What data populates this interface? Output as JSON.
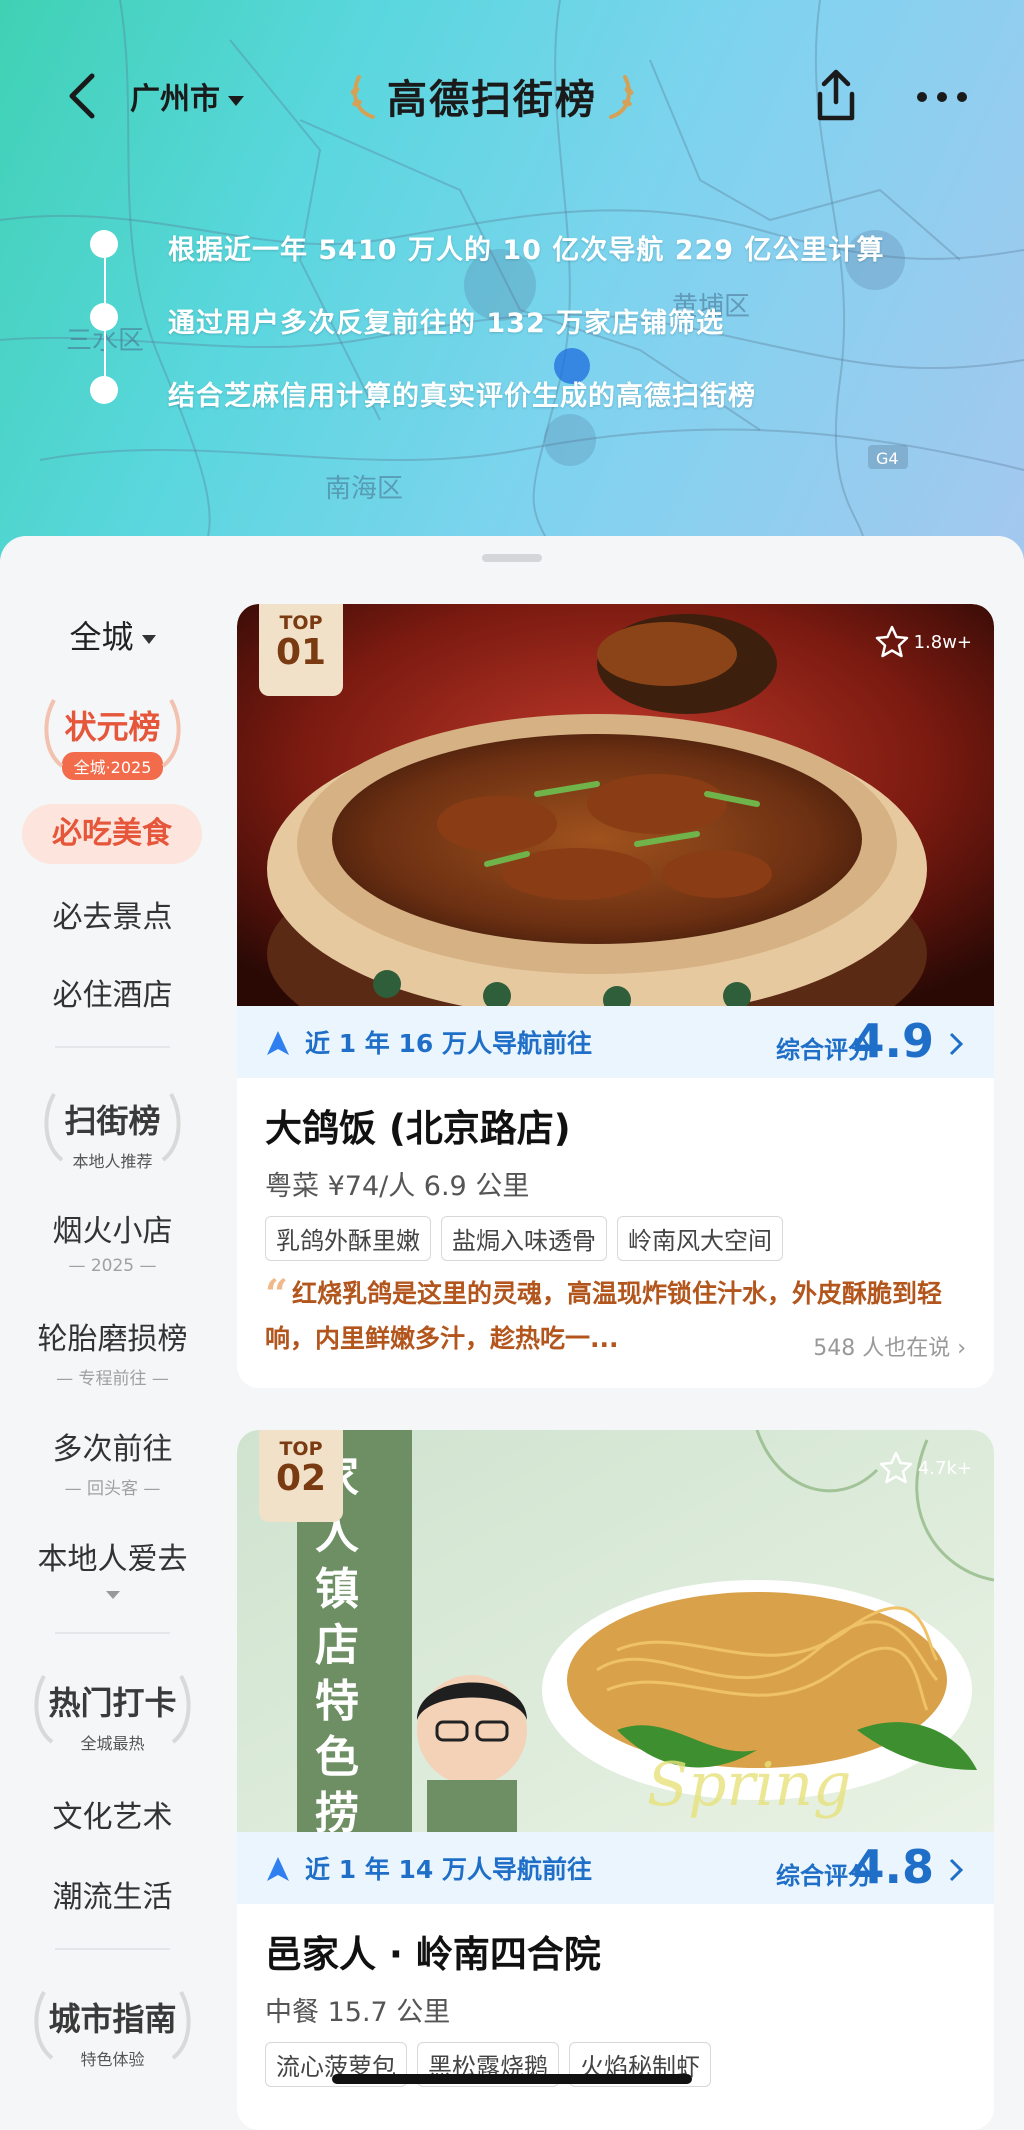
{
  "header": {
    "back_icon": "chevron-left-icon",
    "city": "广州市",
    "brand_title": "高德扫街榜",
    "share_icon": "share-icon",
    "more_icon": "more-dots-icon",
    "map_labels": [
      "三水区",
      "南海区",
      "黄埔区",
      "G4"
    ],
    "facts": [
      "根据近一年 5410 万人的 10 亿次导航 229 亿公里计算",
      "通过用户多次反复前往的 132 万家店铺筛选",
      "结合芝麻信用计算的真实评价生成的高德扫街榜"
    ]
  },
  "sidebar": {
    "scope": "全城",
    "badges": [
      {
        "title": "状元榜",
        "sub": "全城·2025"
      },
      {
        "title": "扫街榜",
        "sub": "本地人推荐"
      },
      {
        "title": "热门打卡",
        "sub": "全城最热"
      },
      {
        "title": "城市指南",
        "sub": "特色体验"
      }
    ],
    "items": [
      {
        "label": "必吃美食",
        "sub": ""
      },
      {
        "label": "必去景点",
        "sub": ""
      },
      {
        "label": "必住酒店",
        "sub": ""
      },
      {
        "label": "烟火小店",
        "sub": "2025"
      },
      {
        "label": "轮胎磨损榜",
        "sub": "专程前往"
      },
      {
        "label": "多次前往",
        "sub": "回头客"
      },
      {
        "label": "本地人爱去",
        "sub": ""
      },
      {
        "label": "文化艺术",
        "sub": ""
      },
      {
        "label": "潮流生活",
        "sub": ""
      }
    ]
  },
  "cards": [
    {
      "rank_top": "TOP",
      "rank_num": "01",
      "fav_count": "1.8w+",
      "nav_text": "近 1 年 16 万人导航前往",
      "score_label": "综合评分",
      "score": "4.9",
      "title": "大鸽饭 (北京路店)",
      "meta": "粤菜  ¥74/人  6.9 公里",
      "tags": [
        "乳鸽外酥里嫩",
        "盐焗入味透骨",
        "岭南风大空间"
      ],
      "review": "红烧乳鸽是这里的灵魂，高温现炸锁住汁水，外皮酥脆到轻响，内里鲜嫩多汁，趁热吃一...",
      "review_count": "548 人也在说"
    },
    {
      "rank_top": "TOP",
      "rank_num": "02",
      "fav_count": "4.7k+",
      "nav_text": "近 1 年 14 万人导航前往",
      "score_label": "综合评分",
      "score": "4.8",
      "title": "邑家人 · 岭南四合院",
      "meta": "中餐  15.7 公里",
      "tags": [
        "流心菠萝包",
        "黑松露烧鹅",
        "火焰秘制虾"
      ],
      "poster_text": "家人镇店特色捞面",
      "poster_script": "Spring"
    }
  ],
  "colors": {
    "accent_red": "#e5563a",
    "nav_blue": "#1f6fc8",
    "review_brown": "#b3561d",
    "rank_tag_bg": "#f1e1c8"
  }
}
